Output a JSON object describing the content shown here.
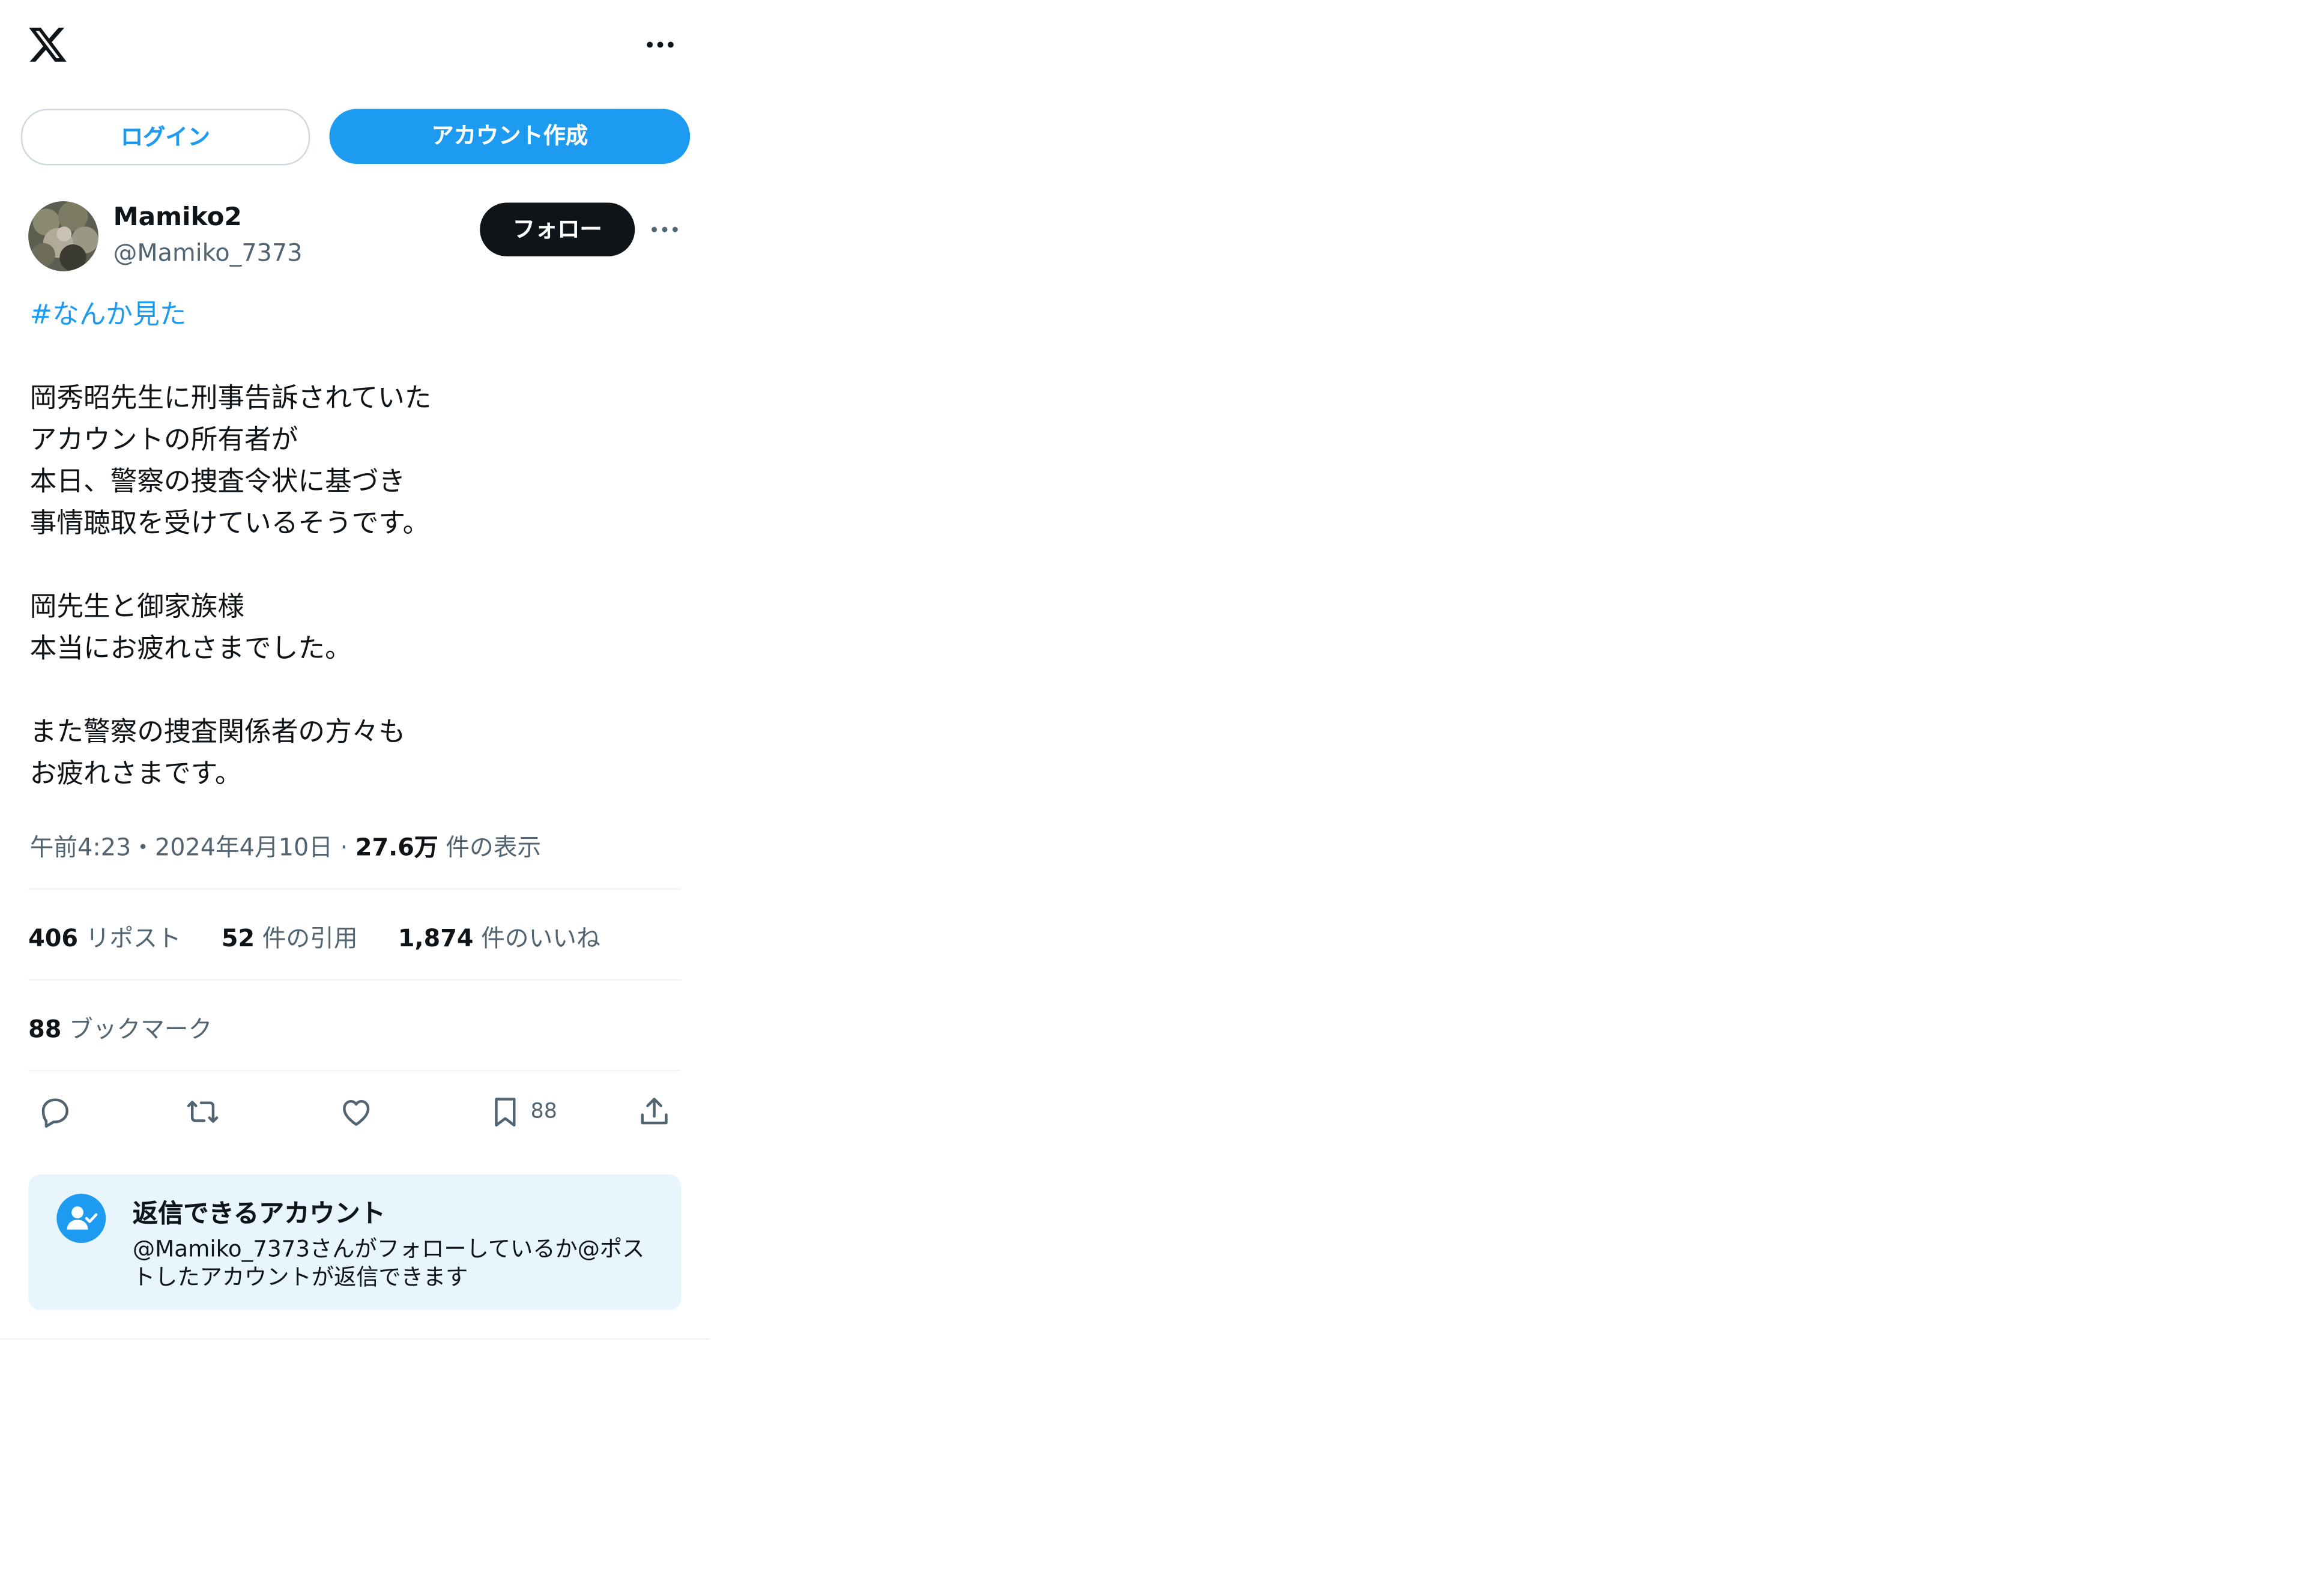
{
  "topbar": {
    "logo_icon": "x-logo-icon",
    "more_icon": "more-horizontal-icon"
  },
  "auth": {
    "login_label": "ログイン",
    "signup_label": "アカウント作成"
  },
  "post": {
    "author": {
      "display_name": "Mamiko2",
      "handle": "@Mamiko_7373",
      "follow_label": "フォロー"
    },
    "hashtag": "#なんか見た",
    "body_lines": [
      "",
      "岡秀昭先生に刑事告訴されていた",
      "アカウントの所有者が",
      "本日、警察の捜査令状に基づき",
      "事情聴取を受けているそうです。",
      "",
      "岡先生と御家族様",
      "本当にお疲れさまでした。",
      "",
      "また警察の捜査関係者の方々も",
      "お疲れさまです。"
    ],
    "meta": {
      "time": "午前4:23",
      "separator": "・",
      "date": "2024年4月10日",
      "separator2": " · ",
      "views_count": "27.6万",
      "views_label": "件の表示"
    },
    "stats": {
      "reposts_count": "406",
      "reposts_label": "リポスト",
      "quotes_count": "52",
      "quotes_label": "件の引用",
      "likes_count": "1,874",
      "likes_label": "件のいいね"
    },
    "bookmarks": {
      "count": "88",
      "label": "ブックマーク"
    },
    "actions": {
      "bookmark_count": "88"
    },
    "reply_restriction": {
      "title": "返信できるアカウント",
      "description": "@Mamiko_7373さんがフォローしているか@ポストしたアカウントが返信できます"
    }
  },
  "colors": {
    "accent": "#1d9bf0",
    "text": "#0f1419",
    "muted": "#536471",
    "card_bg": "#e8f5fd"
  }
}
